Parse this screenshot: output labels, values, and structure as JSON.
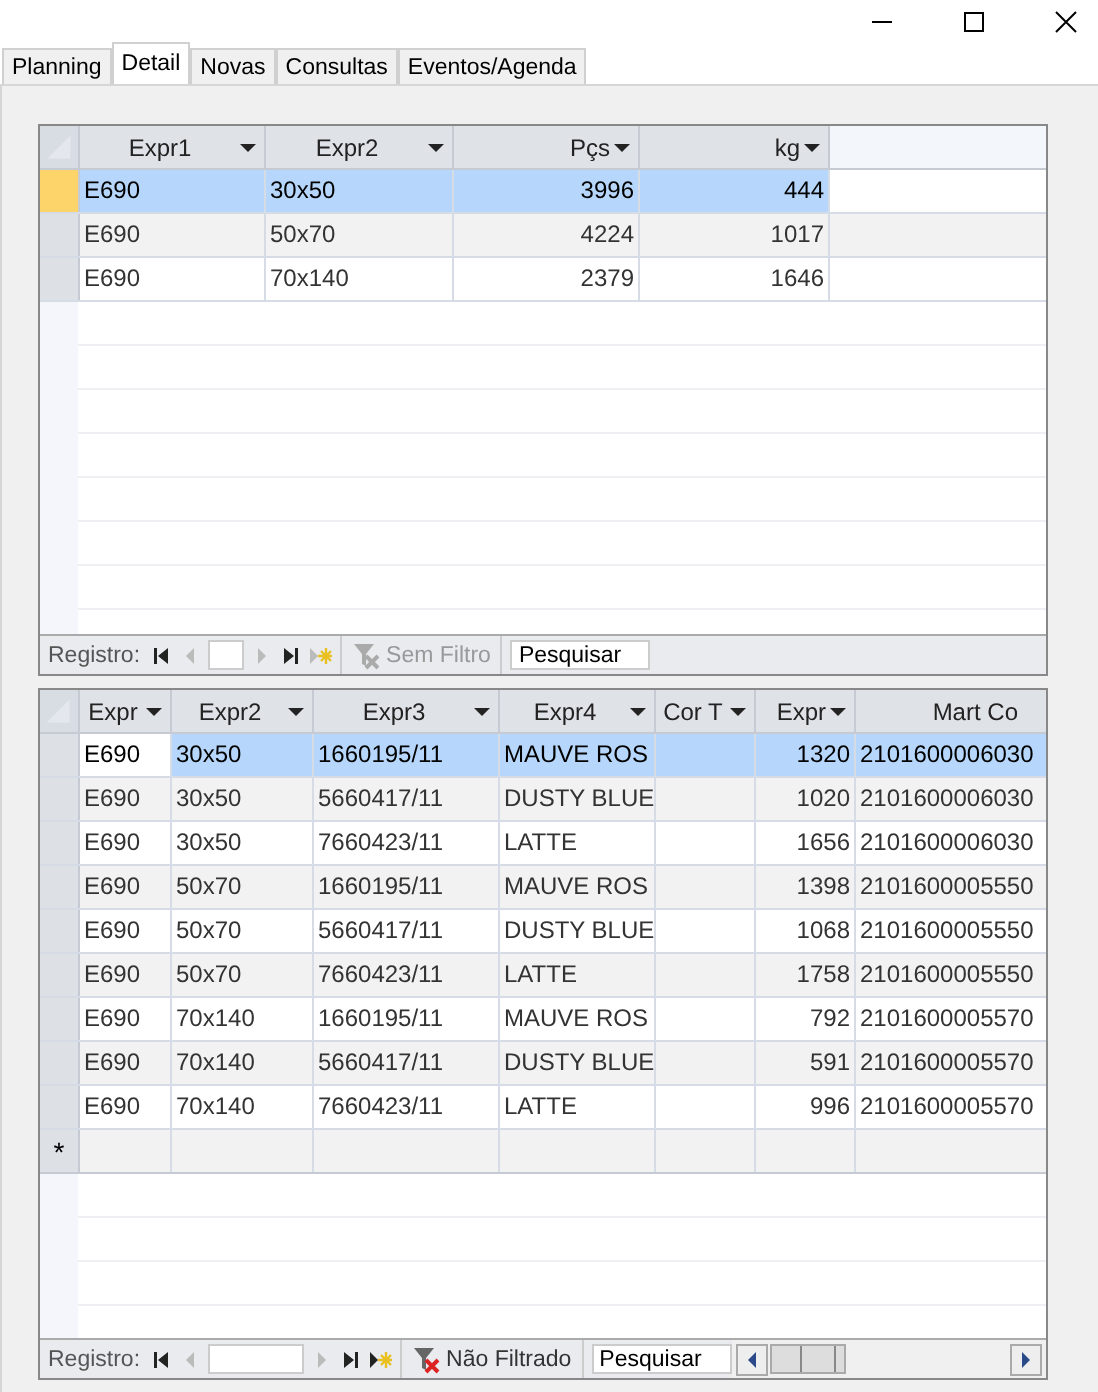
{
  "tabs": [
    {
      "label": "Planning",
      "selected": false
    },
    {
      "label": "Detail",
      "selected": true
    },
    {
      "label": "Novas",
      "selected": false
    },
    {
      "label": "Consultas",
      "selected": false
    },
    {
      "label": "Eventos/Agenda",
      "selected": false
    }
  ],
  "top_grid": {
    "columns": [
      {
        "label": "Expr1",
        "kind": "text"
      },
      {
        "label": "Expr2",
        "kind": "text"
      },
      {
        "label": "Pçs",
        "kind": "number"
      },
      {
        "label": "kg",
        "kind": "number"
      }
    ],
    "rows": [
      {
        "selected": true,
        "current": true,
        "cells": [
          "E690",
          "30x50",
          "3996",
          "444"
        ]
      },
      {
        "selected": false,
        "current": false,
        "cells": [
          "E690",
          "50x70",
          "4224",
          "1017"
        ]
      },
      {
        "selected": false,
        "current": false,
        "cells": [
          "E690",
          "70x140",
          "2379",
          "1646"
        ]
      }
    ],
    "navigator": {
      "label": "Registro:",
      "filter": "Sem Filtro",
      "filter_disabled": true,
      "search_placeholder": "Pesquisar"
    }
  },
  "bottom_grid": {
    "columns": [
      {
        "label": "Expr",
        "kind": "text"
      },
      {
        "label": "Expr2",
        "kind": "text"
      },
      {
        "label": "Expr3",
        "kind": "text"
      },
      {
        "label": "Expr4",
        "kind": "text"
      },
      {
        "label": "Cor T",
        "kind": "text"
      },
      {
        "label": "Expr",
        "kind": "number"
      },
      {
        "label": "Mart Co",
        "kind": "code"
      }
    ],
    "rows": [
      {
        "selected": true,
        "cells": [
          "E690",
          "30x50",
          "1660195/11",
          "MAUVE ROS",
          "",
          "1320",
          "2101600006030"
        ]
      },
      {
        "selected": false,
        "cells": [
          "E690",
          "30x50",
          "5660417/11",
          "DUSTY BLUE",
          "",
          "1020",
          "2101600006030"
        ]
      },
      {
        "selected": false,
        "cells": [
          "E690",
          "30x50",
          "7660423/11",
          "LATTE",
          "",
          "1656",
          "2101600006030"
        ]
      },
      {
        "selected": false,
        "cells": [
          "E690",
          "50x70",
          "1660195/11",
          "MAUVE ROS",
          "",
          "1398",
          "2101600005550"
        ]
      },
      {
        "selected": false,
        "cells": [
          "E690",
          "50x70",
          "5660417/11",
          "DUSTY BLUE",
          "",
          "1068",
          "2101600005550"
        ]
      },
      {
        "selected": false,
        "cells": [
          "E690",
          "50x70",
          "7660423/11",
          "LATTE",
          "",
          "1758",
          "2101600005550"
        ]
      },
      {
        "selected": false,
        "cells": [
          "E690",
          "70x140",
          "1660195/11",
          "MAUVE ROS",
          "",
          "792",
          "2101600005570"
        ]
      },
      {
        "selected": false,
        "cells": [
          "E690",
          "70x140",
          "5660417/11",
          "DUSTY BLUE",
          "",
          "591",
          "2101600005570"
        ]
      },
      {
        "selected": false,
        "cells": [
          "E690",
          "70x140",
          "7660423/11",
          "LATTE",
          "",
          "996",
          "2101600005570"
        ]
      }
    ],
    "new_row_marker": "*",
    "navigator": {
      "label": "Registro:",
      "filter": "Não Filtrado",
      "filter_disabled": false,
      "search_placeholder": "Pesquisar"
    }
  }
}
